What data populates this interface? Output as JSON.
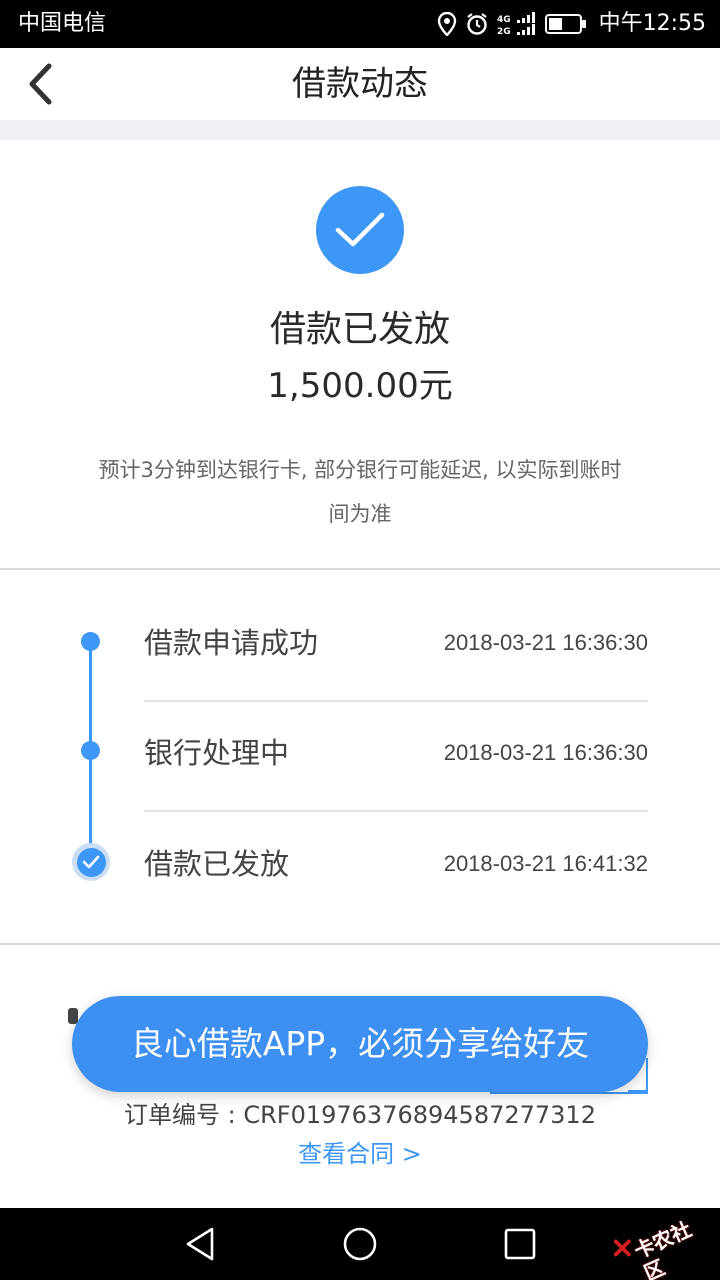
{
  "status_bar": {
    "carrier": "中国电信",
    "network": "4G 2G",
    "clock": "中午12:55"
  },
  "header": {
    "title": "借款动态"
  },
  "hero": {
    "status": "借款已发放",
    "amount": "1,500.00元",
    "note": "预计3分钟到达银行卡, 部分银行可能延迟, 以实际到账时间为准"
  },
  "timeline": [
    {
      "label": "借款申请成功",
      "time": "2018-03-21 16:36:30"
    },
    {
      "label": "银行处理中",
      "time": "2018-03-21 16:36:30"
    },
    {
      "label": "借款已发放",
      "time": "2018-03-21 16:41:32"
    }
  ],
  "toast": "良心借款APP，必须分享给好友",
  "order": {
    "label": "订单编号 : CRF01976376894587277312",
    "contract_link": "查看合同 >"
  },
  "watermark": "卡农社区",
  "colors": {
    "accent": "#3d97f7",
    "toast_bg": "#3d8ff2",
    "band": "#efeff4"
  }
}
